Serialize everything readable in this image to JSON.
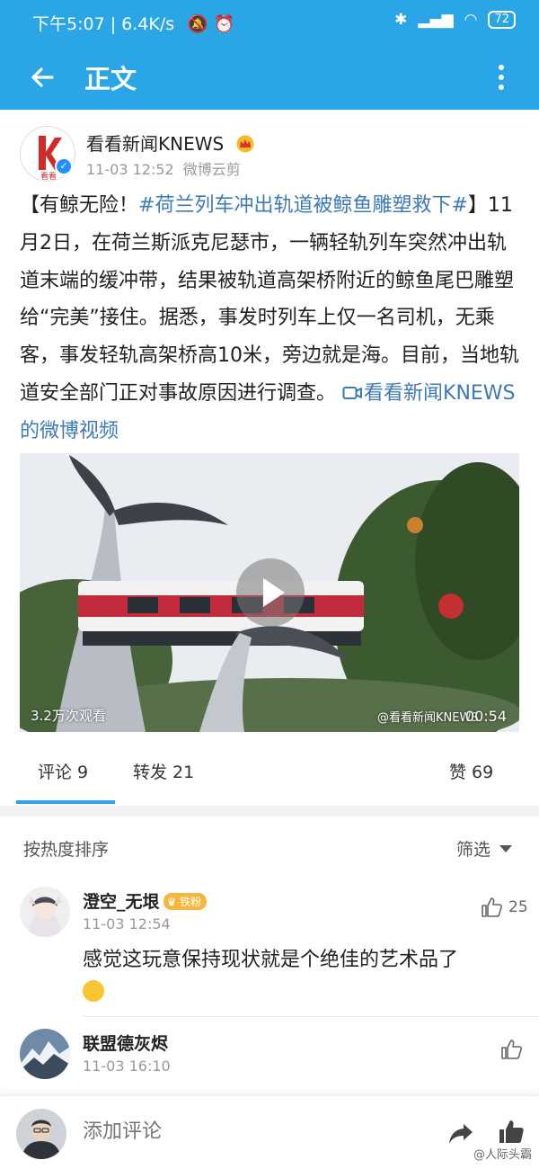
{
  "status_bar": {
    "time_speed": "下午5:07 | 6.4K/s",
    "battery": "72"
  },
  "app_bar": {
    "title": "正文",
    "back_icon": "arrow-left-icon",
    "more_icon": "vertical-dots-icon"
  },
  "post": {
    "author": "看看新闻KNEWS",
    "avatar_text": "看看",
    "time": "11-03 12:52",
    "source": "微博云剪",
    "text_prefix": "【有鲸无险！",
    "hashtag": "#荷兰列车冲出轨道被鲸鱼雕塑救下#",
    "text_body": "】11月2日，在荷兰斯派克尼瑟市，一辆轻轨列车突然冲出轨道末端的缓冲带，结果被轨道高架桥附近的鲸鱼尾巴雕塑给“完美”接住。据悉，事发时列车上仅一名司机，无乘客，事发轻轨高架桥高10米，旁边就是海。目前，当地轨道安全部门正对事故原因进行调查。",
    "video_link": "看看新闻KNEWS的微博视频",
    "video": {
      "views": "3.2万次观看",
      "watermark": "@看看新闻KNEWS",
      "duration": "00:54"
    }
  },
  "tabs": {
    "comments": "评论 9",
    "reposts": "转发 21",
    "likes": "赞 69"
  },
  "sort": {
    "label": "按热度排序",
    "filter": "筛选"
  },
  "comments": [
    {
      "name": "澄空_无垠",
      "badge": "铁粉",
      "time": "11-03 12:54",
      "likes": "25",
      "text": "感觉这玩意保持现状就是个绝佳的艺术品了"
    },
    {
      "name": "联盟德灰烬",
      "time": "11-03 16:10",
      "likes": ""
    }
  ],
  "bottom_bar": {
    "placeholder": "添加评论",
    "source_watermark": "@人际头霸"
  },
  "colors": {
    "brand": "#2aa5e6",
    "link": "#3d7ab8",
    "fan_badge": "#f6b73c"
  }
}
